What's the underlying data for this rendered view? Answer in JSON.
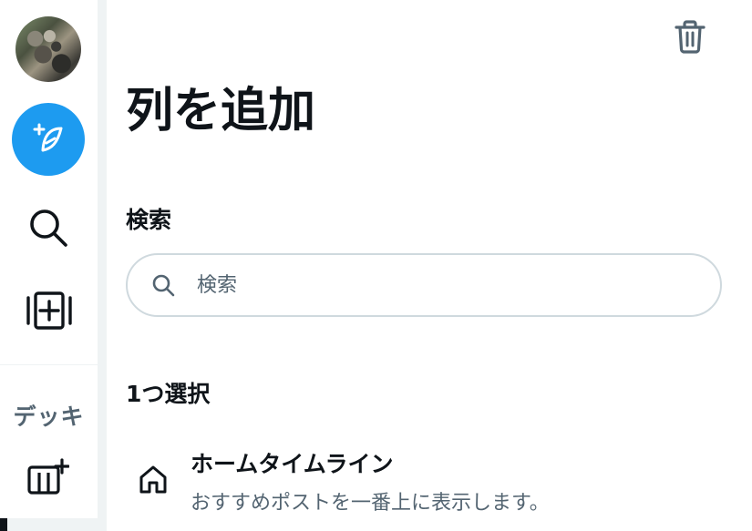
{
  "sidebar": {
    "avatar_alt": "",
    "compose_icon": "compose-quill-icon",
    "search_icon": "search-icon",
    "add_column_icon": "add-column-icon",
    "deck_label": "デッキ",
    "new_deck_icon": "new-deck-icon",
    "accent_color": "#1d9bf0"
  },
  "panel": {
    "delete_icon": "trash-icon",
    "title": "列を追加",
    "search_section_label": "検索",
    "search": {
      "placeholder": "検索",
      "value": ""
    },
    "select_section_label": "1つ選択",
    "items": [
      {
        "icon": "home-icon",
        "title": "ホームタイムライン",
        "description": "おすすめポストを一番上に表示します。"
      }
    ]
  }
}
